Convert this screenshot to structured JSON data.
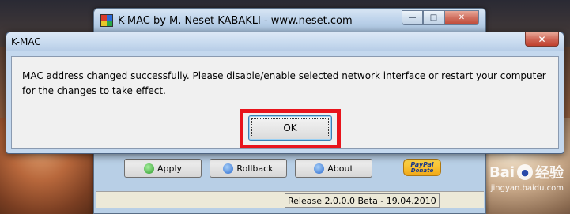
{
  "main_window": {
    "title": "K-MAC by M. Neset KABAKLI  -  www.neset.com",
    "buttons": {
      "apply": "Apply",
      "rollback": "Rollback",
      "about": "About",
      "paypal_logo": "PayPal",
      "paypal_donate": "Donate"
    },
    "status_release": "Release 2.0.0.0 Beta - 19.04.2010"
  },
  "dialog": {
    "title": "K-MAC",
    "message": "MAC address changed successfully. Please disable/enable selected network interface or restart your computer for the changes to take effect.",
    "ok_label": "OK",
    "highlight_color": "#e8141c"
  },
  "watermark": {
    "brand": "Bai",
    "brand_suffix": "经验",
    "url": "jingyan.baidu.com"
  }
}
